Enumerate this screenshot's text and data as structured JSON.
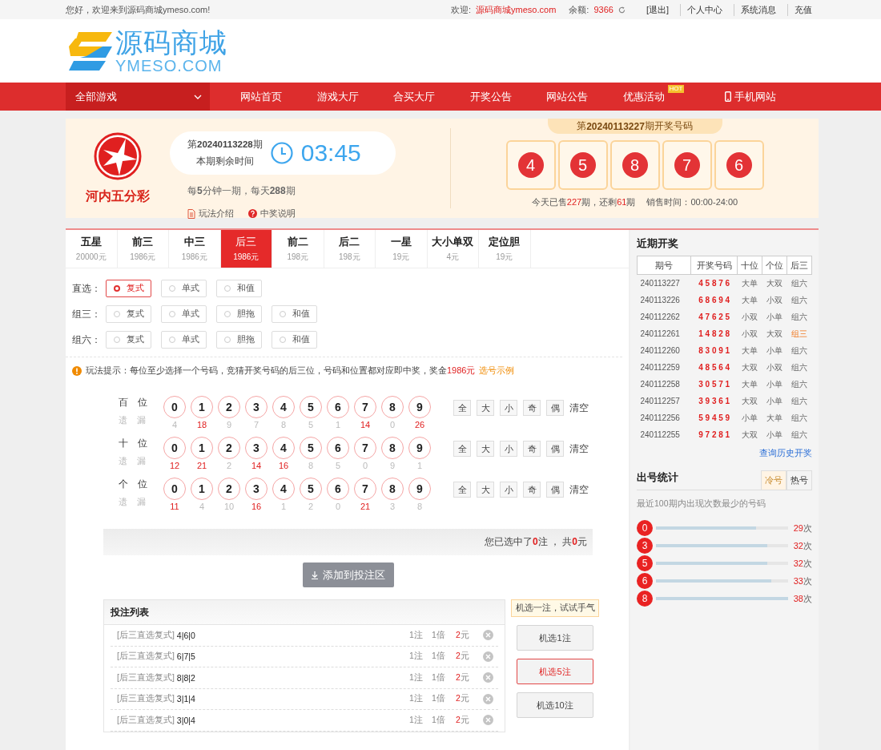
{
  "top_bar": {
    "greeting": "您好，欢迎来到源码商城ymeso.com!",
    "welcome_label": "欢迎:",
    "username": "源码商城ymeso.com",
    "balance_label": "余额:",
    "balance": "9366",
    "links": [
      "[退出]",
      "个人中心",
      "系统消息",
      "充值"
    ]
  },
  "logo": {
    "title": "源码商城",
    "subtitle": "YMESO.COM"
  },
  "nav": {
    "all_games": "全部游戏",
    "items": [
      {
        "label": "网站首页",
        "kind": "plain"
      },
      {
        "label": "游戏大厅",
        "kind": "plain"
      },
      {
        "label": "合买大厅",
        "kind": "plain"
      },
      {
        "label": "开奖公告",
        "kind": "plain"
      },
      {
        "label": "网站公告",
        "kind": "plain"
      },
      {
        "label": "优惠活动",
        "kind": "plain",
        "badge": "HOT"
      },
      {
        "label": "手机网站",
        "kind": "mobile"
      }
    ]
  },
  "game": {
    "name": "河内五分彩",
    "current_issue": "第**20240113228**期",
    "countdown_label": "本期剩余时间",
    "countdown": "03:45",
    "schedule": "每**5**分钟一期，每天**288**期",
    "links": [
      {
        "label": "玩法介绍",
        "kind": "doc"
      },
      {
        "label": "中奖说明",
        "kind": "help"
      }
    ],
    "last_issue": "第**20240113227**期开奖号码",
    "last_numbers": [
      "4",
      "5",
      "8",
      "7",
      "6"
    ],
    "sales": "今天已售**227**期，还剩**61**期",
    "sales_time": "销售时间：00:00-24:00"
  },
  "tabs": [
    {
      "label": "五星",
      "prize": "20000元",
      "selected": false
    },
    {
      "label": "前三",
      "prize": "1986元",
      "selected": false
    },
    {
      "label": "中三",
      "prize": "1986元",
      "selected": false
    },
    {
      "label": "后三",
      "prize": "1986元",
      "selected": true
    },
    {
      "label": "前二",
      "prize": "198元",
      "selected": false
    },
    {
      "label": "后二",
      "prize": "198元",
      "selected": false
    },
    {
      "label": "一星",
      "prize": "19元",
      "selected": false
    },
    {
      "label": "大小单双",
      "prize": "4元",
      "selected": false
    },
    {
      "label": "定位胆",
      "prize": "19元",
      "selected": false
    }
  ],
  "options": [
    {
      "label": "直选：",
      "choices": [
        {
          "label": "复式",
          "selected": true
        },
        {
          "label": "单式",
          "selected": false
        },
        {
          "label": "和值",
          "selected": false
        }
      ]
    },
    {
      "label": "组三：",
      "choices": [
        {
          "label": "复式",
          "selected": false
        },
        {
          "label": "单式",
          "selected": false
        },
        {
          "label": "胆拖",
          "selected": false
        },
        {
          "label": "和值",
          "selected": false
        }
      ]
    },
    {
      "label": "组六：",
      "choices": [
        {
          "label": "复式",
          "selected": false
        },
        {
          "label": "单式",
          "selected": false
        },
        {
          "label": "胆拖",
          "selected": false
        },
        {
          "label": "和值",
          "selected": false
        }
      ]
    }
  ],
  "hint": {
    "text": "玩法提示：每位至少选择一个号码，竞猜开奖号码的后三位，号码和位置都对应即中奖，奖金**1986元**",
    "link": "选号示例"
  },
  "positions": [
    {
      "label": "百位",
      "miss_label": "遗漏",
      "balls": [
        "0",
        "1",
        "2",
        "3",
        "4",
        "5",
        "6",
        "7",
        "8",
        "9"
      ],
      "misses": [
        {
          "value": "4",
          "hot": false
        },
        {
          "value": "18",
          "hot": true
        },
        {
          "value": "9",
          "hot": false
        },
        {
          "value": "7",
          "hot": false
        },
        {
          "value": "8",
          "hot": false
        },
        {
          "value": "5",
          "hot": false
        },
        {
          "value": "1",
          "hot": false
        },
        {
          "value": "14",
          "hot": true
        },
        {
          "value": "0",
          "hot": false
        },
        {
          "value": "26",
          "hot": true
        }
      ],
      "filters": [
        "全",
        "大",
        "小",
        "奇",
        "偶"
      ],
      "clear": "清空"
    },
    {
      "label": "十位",
      "miss_label": "遗漏",
      "balls": [
        "0",
        "1",
        "2",
        "3",
        "4",
        "5",
        "6",
        "7",
        "8",
        "9"
      ],
      "misses": [
        {
          "value": "12",
          "hot": true
        },
        {
          "value": "21",
          "hot": true
        },
        {
          "value": "2",
          "hot": false
        },
        {
          "value": "14",
          "hot": true
        },
        {
          "value": "16",
          "hot": true
        },
        {
          "value": "8",
          "hot": false
        },
        {
          "value": "5",
          "hot": false
        },
        {
          "value": "0",
          "hot": false
        },
        {
          "value": "9",
          "hot": false
        },
        {
          "value": "1",
          "hot": false
        }
      ],
      "filters": [
        "全",
        "大",
        "小",
        "奇",
        "偶"
      ],
      "clear": "清空"
    },
    {
      "label": "个位",
      "miss_label": "遗漏",
      "balls": [
        "0",
        "1",
        "2",
        "3",
        "4",
        "5",
        "6",
        "7",
        "8",
        "9"
      ],
      "misses": [
        {
          "value": "11",
          "hot": true
        },
        {
          "value": "4",
          "hot": false
        },
        {
          "value": "10",
          "hot": false
        },
        {
          "value": "16",
          "hot": true
        },
        {
          "value": "1",
          "hot": false
        },
        {
          "value": "2",
          "hot": false
        },
        {
          "value": "0",
          "hot": false
        },
        {
          "value": "21",
          "hot": true
        },
        {
          "value": "3",
          "hot": false
        },
        {
          "value": "8",
          "hot": false
        }
      ],
      "filters": [
        "全",
        "大",
        "小",
        "奇",
        "偶"
      ],
      "clear": "清空"
    }
  ],
  "selection_summary": "您已选中了**0**注 ， 共**0**元",
  "add_button": "添加到投注区",
  "bet_list": {
    "title": "投注列表",
    "rows": [
      {
        "type": "[后三直选复式]",
        "numbers": "4|6|0",
        "count": "1注",
        "multiple": "1倍",
        "amount": "2",
        "unit": "元"
      },
      {
        "type": "[后三直选复式]",
        "numbers": "6|7|5",
        "count": "1注",
        "multiple": "1倍",
        "amount": "2",
        "unit": "元"
      },
      {
        "type": "[后三直选复式]",
        "numbers": "8|8|2",
        "count": "1注",
        "multiple": "1倍",
        "amount": "2",
        "unit": "元"
      },
      {
        "type": "[后三直选复式]",
        "numbers": "3|1|4",
        "count": "1注",
        "multiple": "1倍",
        "amount": "2",
        "unit": "元"
      },
      {
        "type": "[后三直选复式]",
        "numbers": "3|0|4",
        "count": "1注",
        "multiple": "1倍",
        "amount": "2",
        "unit": "元"
      }
    ]
  },
  "random_pick": {
    "tip": "机选一注，试试手气",
    "buttons": [
      {
        "label": "机选1注",
        "selected": false
      },
      {
        "label": "机选5注",
        "selected": true
      },
      {
        "label": "机选10注",
        "selected": false
      }
    ]
  },
  "recent_draws": {
    "title": "近期开奖",
    "columns": [
      "期号",
      "开奖号码",
      "十位",
      "个位",
      "后三"
    ],
    "rows": [
      {
        "issue": "240113227",
        "numbers": "4 5 8 7 6",
        "tens": "大单",
        "ones": "大双",
        "group": "组六",
        "highlight": false
      },
      {
        "issue": "240113226",
        "numbers": "6 8 6 9 4",
        "tens": "大单",
        "ones": "小双",
        "group": "组六",
        "highlight": false
      },
      {
        "issue": "240112262",
        "numbers": "4 7 6 2 5",
        "tens": "小双",
        "ones": "小单",
        "group": "组六",
        "highlight": false
      },
      {
        "issue": "240112261",
        "numbers": "1 4 8 2 8",
        "tens": "小双",
        "ones": "大双",
        "group": "组三",
        "highlight": true
      },
      {
        "issue": "240112260",
        "numbers": "8 3 0 9 1",
        "tens": "大单",
        "ones": "小单",
        "group": "组六",
        "highlight": false
      },
      {
        "issue": "240112259",
        "numbers": "4 8 5 6 4",
        "tens": "大双",
        "ones": "小双",
        "group": "组六",
        "highlight": false
      },
      {
        "issue": "240112258",
        "numbers": "3 0 5 7 1",
        "tens": "大单",
        "ones": "小单",
        "group": "组六",
        "highlight": false
      },
      {
        "issue": "240112257",
        "numbers": "3 9 3 6 1",
        "tens": "大双",
        "ones": "小单",
        "group": "组六",
        "highlight": false
      },
      {
        "issue": "240112256",
        "numbers": "5 9 4 5 9",
        "tens": "小单",
        "ones": "大单",
        "group": "组六",
        "highlight": false
      },
      {
        "issue": "240112255",
        "numbers": "9 7 2 8 1",
        "tens": "大双",
        "ones": "小单",
        "group": "组六",
        "highlight": false
      }
    ],
    "link": "查询历史开奖"
  },
  "stats": {
    "title": "出号统计",
    "tabs": [
      {
        "label": "冷号",
        "selected": true
      },
      {
        "label": "热号",
        "selected": false
      }
    ],
    "caption": "最近100期内出现次数最少的号码",
    "items": [
      {
        "number": "0",
        "level": 0.76,
        "count": "**29**次"
      },
      {
        "number": "3",
        "level": 0.84,
        "count": "**32**次"
      },
      {
        "number": "5",
        "level": 0.84,
        "count": "**32**次"
      },
      {
        "number": "6",
        "level": 0.87,
        "count": "**33**次"
      },
      {
        "number": "8",
        "level": 1.0,
        "count": "**38**次"
      }
    ]
  }
}
